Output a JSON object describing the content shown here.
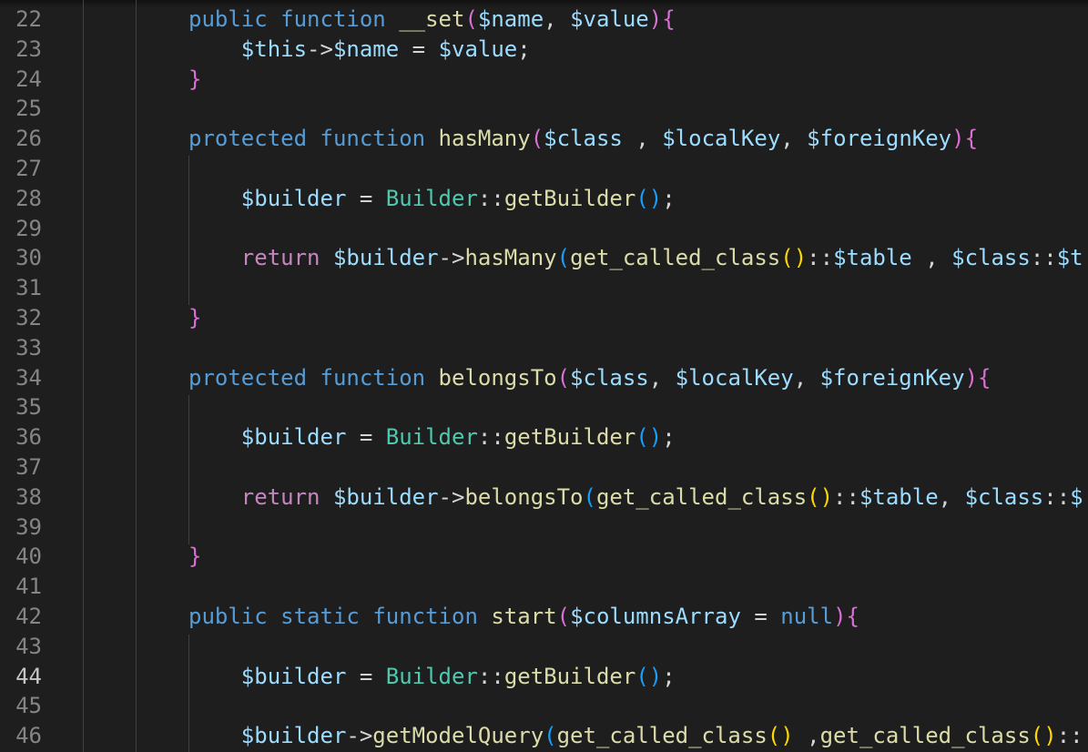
{
  "editor": {
    "active_line": "44",
    "lines": [
      {
        "n": "22",
        "code": [
          [
            "kw",
            "public"
          ],
          [
            "op",
            " "
          ],
          [
            "kw",
            "function"
          ],
          [
            "op",
            " "
          ],
          [
            "fn",
            "__set"
          ],
          [
            "par",
            "("
          ],
          [
            "var",
            "$name"
          ],
          [
            "op",
            ", "
          ],
          [
            "var",
            "$value"
          ],
          [
            "par",
            "){"
          ]
        ]
      },
      {
        "n": "23",
        "code": [
          [
            "op",
            "    "
          ],
          [
            "var",
            "$this"
          ],
          [
            "op",
            "->"
          ],
          [
            "var",
            "$name"
          ],
          [
            "op",
            " = "
          ],
          [
            "var",
            "$value"
          ],
          [
            "op",
            ";"
          ]
        ]
      },
      {
        "n": "24",
        "code": [
          [
            "par",
            "}"
          ]
        ]
      },
      {
        "n": "25",
        "code": []
      },
      {
        "n": "26",
        "code": [
          [
            "kw",
            "protected"
          ],
          [
            "op",
            " "
          ],
          [
            "kw",
            "function"
          ],
          [
            "op",
            " "
          ],
          [
            "fn",
            "hasMany"
          ],
          [
            "par",
            "("
          ],
          [
            "var",
            "$class"
          ],
          [
            "op",
            " , "
          ],
          [
            "var",
            "$localKey"
          ],
          [
            "op",
            ", "
          ],
          [
            "var",
            "$foreignKey"
          ],
          [
            "par",
            "){"
          ]
        ]
      },
      {
        "n": "27",
        "code": []
      },
      {
        "n": "28",
        "code": [
          [
            "op",
            "    "
          ],
          [
            "var",
            "$builder"
          ],
          [
            "op",
            " = "
          ],
          [
            "cls",
            "Builder"
          ],
          [
            "op",
            "::"
          ],
          [
            "fn",
            "getBuilder"
          ],
          [
            "par2",
            "()"
          ],
          [
            "op",
            ";"
          ]
        ]
      },
      {
        "n": "29",
        "code": []
      },
      {
        "n": "30",
        "code": [
          [
            "op",
            "    "
          ],
          [
            "ctl",
            "return"
          ],
          [
            "op",
            " "
          ],
          [
            "var",
            "$builder"
          ],
          [
            "op",
            "->"
          ],
          [
            "fn",
            "hasMany"
          ],
          [
            "par2",
            "("
          ],
          [
            "fn",
            "get_called_class"
          ],
          [
            "par3",
            "()"
          ],
          [
            "op",
            "::"
          ],
          [
            "var",
            "$table"
          ],
          [
            "op",
            " , "
          ],
          [
            "var",
            "$class"
          ],
          [
            "op",
            "::"
          ],
          [
            "var",
            "$t"
          ]
        ]
      },
      {
        "n": "31",
        "code": []
      },
      {
        "n": "32",
        "code": [
          [
            "par",
            "}"
          ]
        ]
      },
      {
        "n": "33",
        "code": []
      },
      {
        "n": "34",
        "code": [
          [
            "kw",
            "protected"
          ],
          [
            "op",
            " "
          ],
          [
            "kw",
            "function"
          ],
          [
            "op",
            " "
          ],
          [
            "fn",
            "belongsTo"
          ],
          [
            "par",
            "("
          ],
          [
            "var",
            "$class"
          ],
          [
            "op",
            ", "
          ],
          [
            "var",
            "$localKey"
          ],
          [
            "op",
            ", "
          ],
          [
            "var",
            "$foreignKey"
          ],
          [
            "par",
            "){"
          ]
        ]
      },
      {
        "n": "35",
        "code": []
      },
      {
        "n": "36",
        "code": [
          [
            "op",
            "    "
          ],
          [
            "var",
            "$builder"
          ],
          [
            "op",
            " = "
          ],
          [
            "cls",
            "Builder"
          ],
          [
            "op",
            "::"
          ],
          [
            "fn",
            "getBuilder"
          ],
          [
            "par2",
            "()"
          ],
          [
            "op",
            ";"
          ]
        ]
      },
      {
        "n": "37",
        "code": []
      },
      {
        "n": "38",
        "code": [
          [
            "op",
            "    "
          ],
          [
            "ctl",
            "return"
          ],
          [
            "op",
            " "
          ],
          [
            "var",
            "$builder"
          ],
          [
            "op",
            "->"
          ],
          [
            "fn",
            "belongsTo"
          ],
          [
            "par2",
            "("
          ],
          [
            "fn",
            "get_called_class"
          ],
          [
            "par3",
            "()"
          ],
          [
            "op",
            "::"
          ],
          [
            "var",
            "$table"
          ],
          [
            "op",
            ", "
          ],
          [
            "var",
            "$class"
          ],
          [
            "op",
            "::"
          ],
          [
            "var",
            "$"
          ]
        ]
      },
      {
        "n": "39",
        "code": []
      },
      {
        "n": "40",
        "code": [
          [
            "par",
            "}"
          ]
        ]
      },
      {
        "n": "41",
        "code": []
      },
      {
        "n": "42",
        "code": [
          [
            "kw",
            "public"
          ],
          [
            "op",
            " "
          ],
          [
            "kw",
            "static"
          ],
          [
            "op",
            " "
          ],
          [
            "kw",
            "function"
          ],
          [
            "op",
            " "
          ],
          [
            "fn",
            "start"
          ],
          [
            "par",
            "("
          ],
          [
            "var",
            "$columnsArray"
          ],
          [
            "op",
            " = "
          ],
          [
            "kw",
            "null"
          ],
          [
            "par",
            "){"
          ]
        ]
      },
      {
        "n": "43",
        "code": []
      },
      {
        "n": "44",
        "code": [
          [
            "op",
            "    "
          ],
          [
            "var",
            "$builder"
          ],
          [
            "op",
            " = "
          ],
          [
            "cls",
            "Builder"
          ],
          [
            "op",
            "::"
          ],
          [
            "fn",
            "getBuilder"
          ],
          [
            "par2",
            "()"
          ],
          [
            "op",
            ";"
          ]
        ]
      },
      {
        "n": "45",
        "code": []
      },
      {
        "n": "46",
        "code": [
          [
            "op",
            "    "
          ],
          [
            "var",
            "$builder"
          ],
          [
            "op",
            "->"
          ],
          [
            "fn",
            "getModelQuery"
          ],
          [
            "par2",
            "("
          ],
          [
            "fn",
            "get_called_class"
          ],
          [
            "par3",
            "()"
          ],
          [
            "op",
            " ,"
          ],
          [
            "fn",
            "get_called_class"
          ],
          [
            "par3",
            "()"
          ],
          [
            "op",
            "::"
          ]
        ]
      }
    ]
  }
}
